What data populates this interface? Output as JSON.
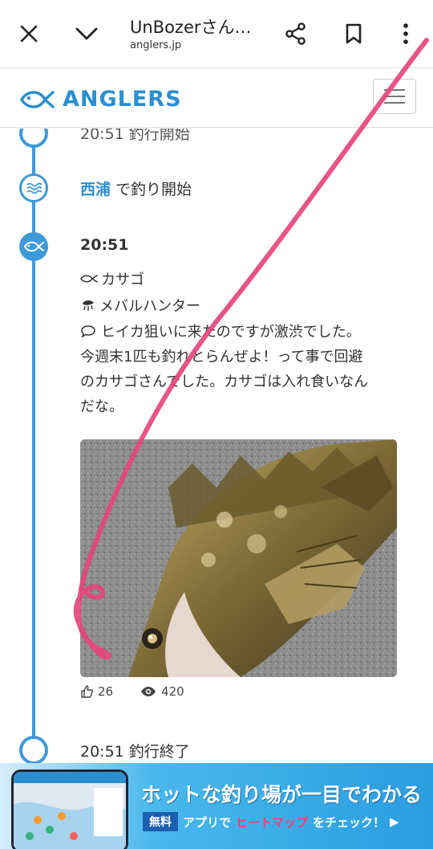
{
  "browser": {
    "title": "UnBozerさん…",
    "url": "anglers.jp"
  },
  "site": {
    "logo_text": "ANGLERS"
  },
  "timeline": {
    "start_time_partial": "20:51 釣行開始",
    "location_name": "西浦",
    "location_suffix": " で釣り開始",
    "catch_time": "20:51",
    "species": "カサゴ",
    "lure": "メバルハンター",
    "comment_lines": [
      "ヒイカ狙いに来たのですが激渋でした。",
      "今週末1匹も釣れとらんぜよ！って事で回避",
      "のカサゴさんでした。カサゴは入れ食いなん",
      "だな。"
    ],
    "likes": "26",
    "views": "420",
    "end_label": "20:51 釣行終了"
  },
  "ad": {
    "headline": "ホットな釣り場が一目でわかる",
    "badge": "無料",
    "sub_prefix": "アプリで",
    "sub_highlight": "ヒートマップ",
    "sub_suffix": "をチェック！"
  },
  "colors": {
    "accent": "#3d9ad9",
    "brand": "#2b8fd0"
  }
}
